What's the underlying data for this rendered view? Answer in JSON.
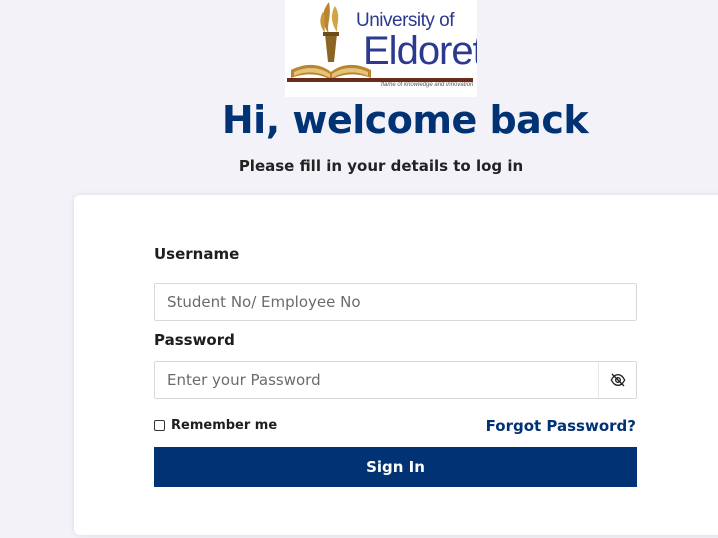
{
  "logo": {
    "line1": "University of",
    "line2": "Eldoret",
    "motto": "flame of knowledge and innovation"
  },
  "header": {
    "title": "Hi, welcome back",
    "subtitle": "Please fill in your details to log in"
  },
  "form": {
    "username": {
      "label": "Username",
      "value": "",
      "placeholder": "Student No/ Employee No"
    },
    "password": {
      "label": "Password",
      "value": "",
      "placeholder": "Enter your Password",
      "toggle_icon": "eye-off-icon"
    },
    "remember_me": {
      "label": "Remember me",
      "checked": false
    },
    "forgot_password_label": "Forgot Password?",
    "submit_label": "Sign In"
  },
  "colors": {
    "brand_navy": "#003274",
    "logo_blue": "#2b3990",
    "logo_gold": "#b8862e",
    "background": "#f3f2f8"
  }
}
